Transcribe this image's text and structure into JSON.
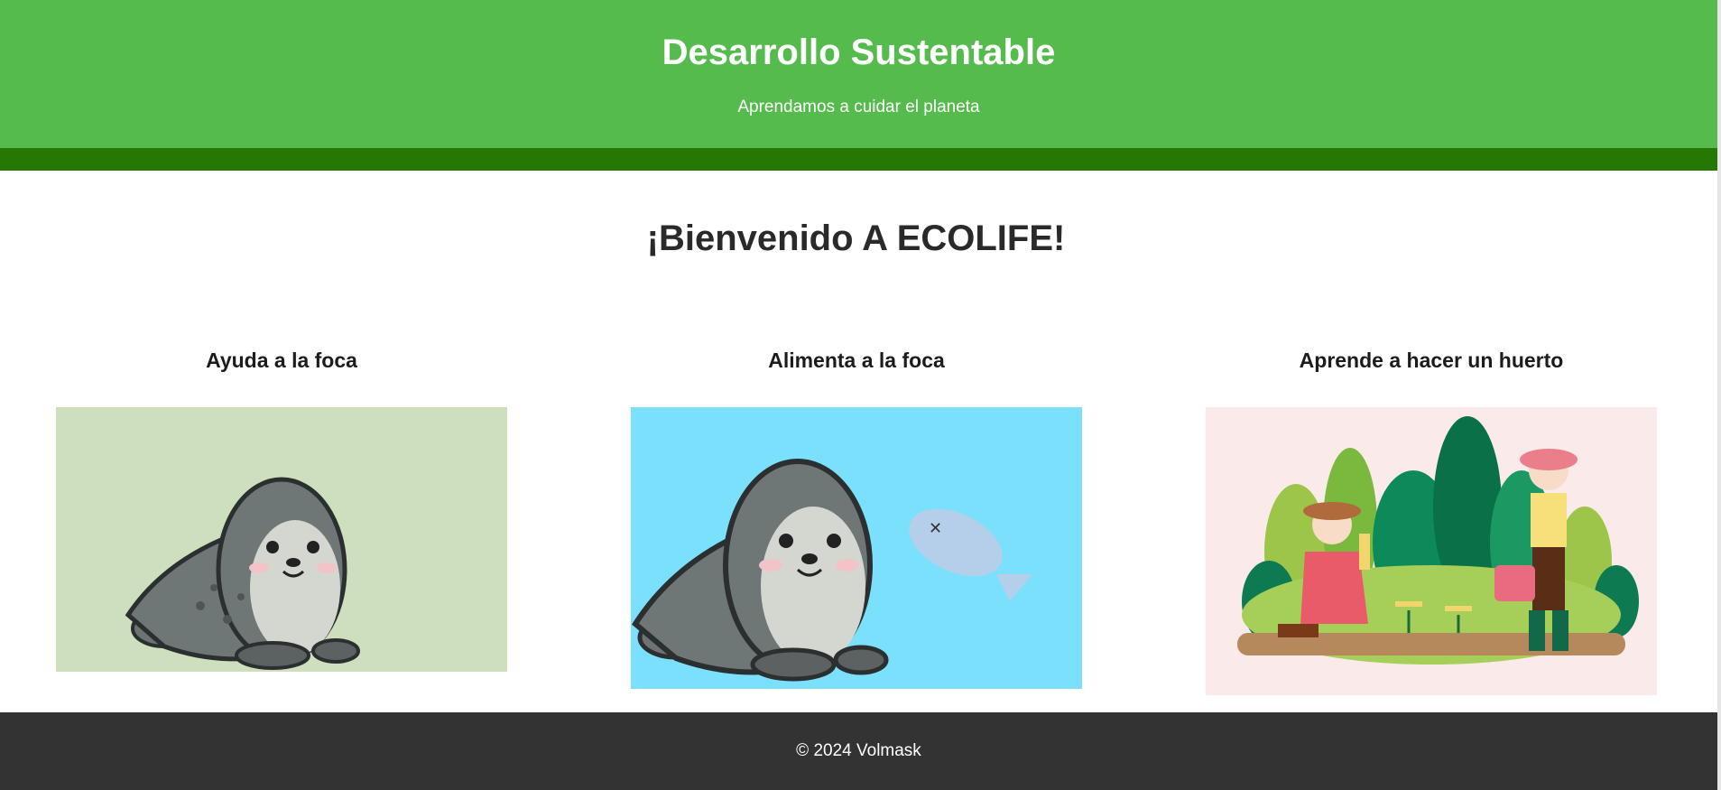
{
  "header": {
    "title": "Desarrollo Sustentable",
    "subtitle": "Aprendamos a cuidar el planeta"
  },
  "main": {
    "heading": "¡Bienvenido A ECOLIFE!",
    "cards": [
      {
        "title": "Ayuda a la foca"
      },
      {
        "title": "Alimenta a la foca"
      },
      {
        "title": "Aprende a hacer un huerto"
      }
    ]
  },
  "footer": {
    "text": "© 2024 Volmask"
  },
  "colors": {
    "header_bg": "#55bb4c",
    "nav_bar": "#267804",
    "footer_bg": "#333333",
    "card1_bg": "#cddfbc",
    "card2_bg": "#7be0fb",
    "card3_bg": "#fbeaea"
  }
}
